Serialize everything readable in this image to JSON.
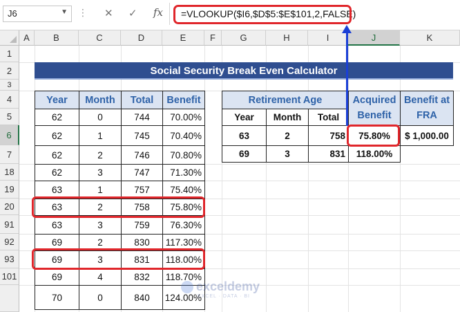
{
  "formula_bar": {
    "name_box": "J6",
    "dots": "⋮",
    "cancel_icon": "✕",
    "enter_icon": "✓",
    "fx_label": "fx",
    "formula": "=VLOOKUP($I6,$D$5:$E$101,2,FALSE)"
  },
  "columns": [
    "A",
    "B",
    "C",
    "D",
    "E",
    "F",
    "G",
    "H",
    "I",
    "J",
    "K"
  ],
  "selected_column": "J",
  "rows": [
    "1",
    "2",
    "3",
    "4",
    "5",
    "6",
    "7",
    "18",
    "19",
    "20",
    "91",
    "92",
    "93",
    "101"
  ],
  "selected_row": "6",
  "banner_title": "Social Security Break Even Calculator",
  "left_table": {
    "headers": [
      "Year",
      "Month",
      "Total",
      "Benefit"
    ],
    "rows": [
      [
        "62",
        "0",
        "744",
        "70.00%"
      ],
      [
        "62",
        "1",
        "745",
        "70.40%"
      ],
      [
        "62",
        "2",
        "746",
        "70.80%"
      ],
      [
        "62",
        "3",
        "747",
        "71.30%"
      ],
      [
        "63",
        "1",
        "757",
        "75.40%"
      ],
      [
        "63",
        "2",
        "758",
        "75.80%"
      ],
      [
        "63",
        "3",
        "759",
        "76.30%"
      ],
      [
        "69",
        "2",
        "830",
        "117.30%"
      ],
      [
        "69",
        "3",
        "831",
        "118.00%"
      ],
      [
        "69",
        "4",
        "832",
        "118.70%"
      ],
      [
        "70",
        "0",
        "840",
        "124.00%"
      ]
    ]
  },
  "right_table": {
    "retirement_age_header": "Retirement Age",
    "sub_headers": [
      "Year",
      "Month",
      "Total"
    ],
    "acquired_benefit_header": "Acquired Benefit",
    "benefit_fra_header": "Benefit at FRA",
    "rows": [
      [
        "63",
        "2",
        "758",
        "75.80%"
      ],
      [
        "69",
        "3",
        "831",
        "118.00%"
      ]
    ],
    "benefit_fra_value": "$ 1,000.00"
  },
  "watermark": {
    "name": "exceldemy",
    "tagline": "EXCEL · DATA · BI"
  },
  "colors": {
    "banner": "#2f4e90",
    "header_fill": "#dbe4f2",
    "header_text": "#2e62a8",
    "highlight": "#e0262b",
    "arrow": "#1a3fd6",
    "selection": "#217346"
  }
}
